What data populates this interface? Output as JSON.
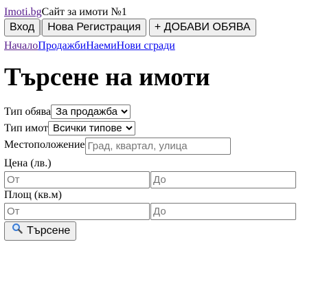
{
  "header": {
    "logo": "Imoti.bg",
    "tagline": "Сайт за имоти №1"
  },
  "auth": {
    "login": "Вход",
    "register": "Нова Регистрация",
    "add_listing": "+ ДОБАВИ ОБЯВА"
  },
  "nav": {
    "items": [
      "Начало",
      "Продажби",
      "Наеми",
      "Нови сгради"
    ]
  },
  "page_title": "Търсене на имоти",
  "search": {
    "listing_type_label": "Тип обява",
    "listing_type_value": "За продажба",
    "property_type_label": "Тип имот",
    "property_type_value": "Всички типове",
    "location_label": "Местоположение",
    "location_placeholder": "Град, квартал, улица",
    "price_label": "Цена (лв.)",
    "price_from_placeholder": "От",
    "price_to_placeholder": "До",
    "area_label": "Площ (кв.м)",
    "area_from_placeholder": "От",
    "area_to_placeholder": "До",
    "submit_label": "Търсене",
    "submit_icon": "magnifier-icon"
  }
}
